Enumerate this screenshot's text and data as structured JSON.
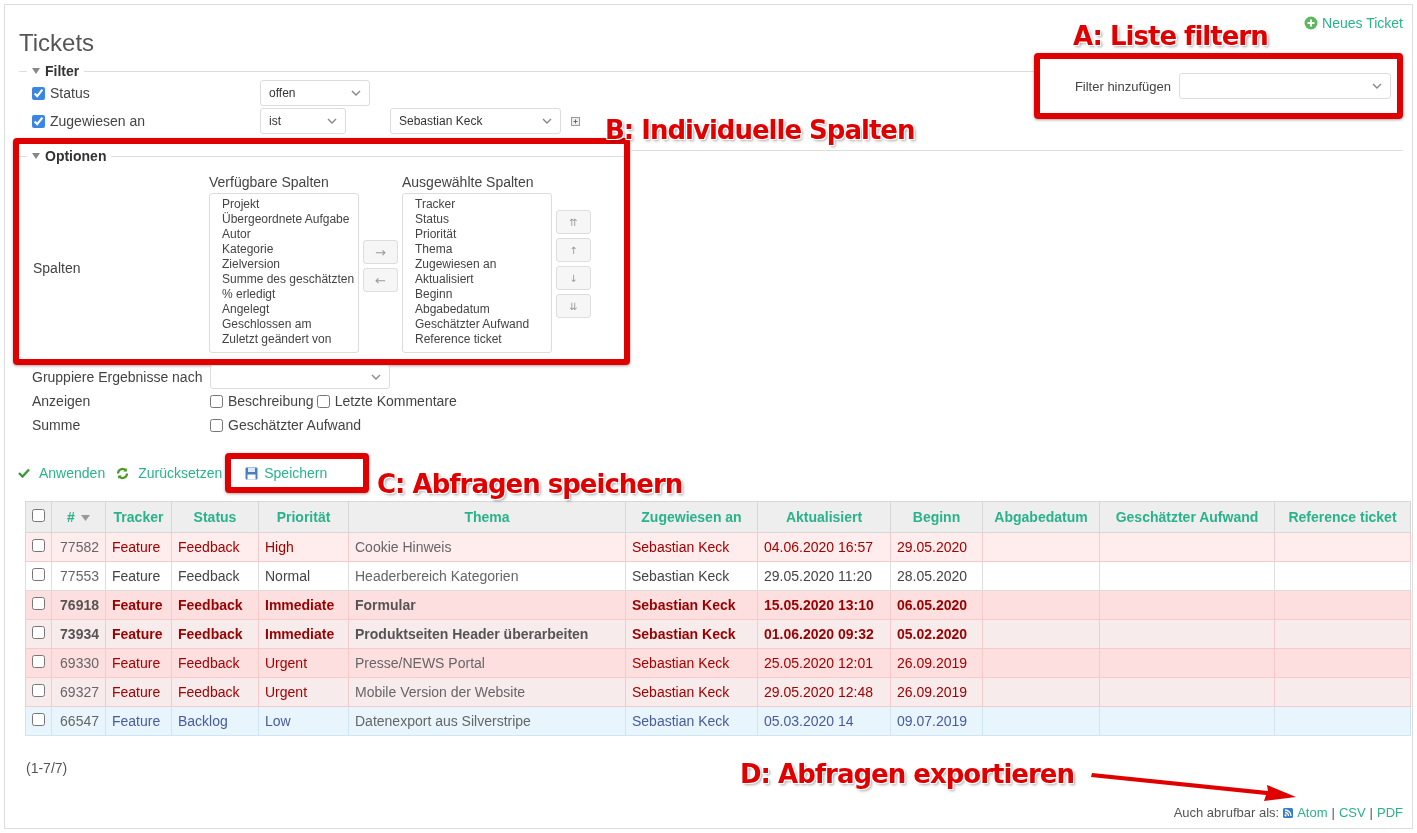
{
  "page": {
    "title": "Tickets",
    "new_link": "Neues Ticket"
  },
  "filter": {
    "legend": "Filter",
    "rows": [
      {
        "label": "Status",
        "checked": true,
        "operator": "offen"
      },
      {
        "label": "Zugewiesen an",
        "checked": true,
        "operator": "ist",
        "value": "Sebastian Keck"
      }
    ],
    "add_label": "Filter hinzufügen"
  },
  "options": {
    "legend": "Optionen",
    "columns_label": "Spalten",
    "available_title": "Verfügbare Spalten",
    "available": [
      "Projekt",
      "Übergeordnete Aufgabe",
      "Autor",
      "Kategorie",
      "Zielversion",
      "Summe des geschätzten",
      "% erledigt",
      "Angelegt",
      "Geschlossen am",
      "Zuletzt geändert von"
    ],
    "selected_title": "Ausgewählte Spalten",
    "selected": [
      "Tracker",
      "Status",
      "Priorität",
      "Thema",
      "Zugewiesen an",
      "Aktualisiert",
      "Beginn",
      "Abgabedatum",
      "Geschätzter Aufwand",
      "Reference ticket"
    ],
    "move_buttons": [
      "→",
      "←"
    ],
    "order_buttons": [
      "⇈",
      "↑",
      "↓",
      "⇊"
    ]
  },
  "group_by": {
    "label": "Gruppiere Ergebnisse nach"
  },
  "show": {
    "label": "Anzeigen",
    "options": [
      {
        "label": "Beschreibung",
        "checked": false
      },
      {
        "label": "Letzte Kommentare",
        "checked": false
      }
    ]
  },
  "totals": {
    "label": "Summe",
    "options": [
      {
        "label": "Geschätzter Aufwand",
        "checked": false
      }
    ]
  },
  "actions": [
    {
      "label": "Anwenden",
      "kind": "apply"
    },
    {
      "label": "Zurücksetzen",
      "kind": "reset"
    },
    {
      "label": "Speichern",
      "kind": "save"
    }
  ],
  "table": {
    "all_checked": false,
    "columns": [
      "#",
      "Tracker",
      "Status",
      "Priorität",
      "Thema",
      "Zugewiesen an",
      "Aktualisiert",
      "Beginn",
      "Abgabedatum",
      "Geschätzter Aufwand",
      "Reference ticket"
    ],
    "rows": [
      {
        "checked": false,
        "kind": "high",
        "cells": [
          "77582",
          "Feature",
          "Feedback",
          "High",
          "Cookie Hinweis",
          "Sebastian Keck",
          "04.06.2020 16:57",
          "29.05.2020"
        ]
      },
      {
        "checked": false,
        "kind": "normal",
        "cells": [
          "77553",
          "Feature",
          "Feedback",
          "Normal",
          "Headerbereich Kategorien",
          "Sebastian Keck",
          "29.05.2020 11:20",
          "28.05.2020"
        ]
      },
      {
        "checked": false,
        "kind": "immediate",
        "cells": [
          "76918",
          "Feature",
          "Feedback",
          "Immediate",
          "Formular",
          "Sebastian Keck",
          "15.05.2020 13:10",
          "06.05.2020"
        ]
      },
      {
        "checked": false,
        "kind": "immediate",
        "cells": [
          "73934",
          "Feature",
          "Feedback",
          "Immediate",
          "Produktseiten Header überarbeiten",
          "Sebastian Keck",
          "01.06.2020 09:32",
          "05.02.2020"
        ]
      },
      {
        "checked": false,
        "kind": "urgent",
        "cells": [
          "69330",
          "Feature",
          "Feedback",
          "Urgent",
          "Presse/NEWS Portal",
          "Sebastian Keck",
          "25.05.2020 12:01",
          "26.09.2019"
        ]
      },
      {
        "checked": false,
        "kind": "urgent",
        "cells": [
          "69327",
          "Feature",
          "Feedback",
          "Urgent",
          "Mobile Version der Website",
          "Sebastian Keck",
          "29.05.2020 12:48",
          "26.09.2019"
        ]
      },
      {
        "checked": false,
        "kind": "low",
        "cells": [
          "66547",
          "Feature",
          "Backlog",
          "Low",
          "Datenexport aus Silverstripe",
          "Sebastian Keck",
          "05.03.2020 14",
          "09.07.2019"
        ]
      }
    ]
  },
  "pagination": "(1-7/7)",
  "export": {
    "label": "Auch abrufbar als:",
    "separator": "|",
    "links": [
      "Atom",
      "CSV",
      "PDF"
    ]
  },
  "annotations": [
    {
      "label": "A: Liste filtern"
    },
    {
      "label": "B: Individuelle Spalten"
    },
    {
      "label": "C: Abfragen speichern"
    },
    {
      "label": "D: Abfragen exportieren"
    }
  ]
}
